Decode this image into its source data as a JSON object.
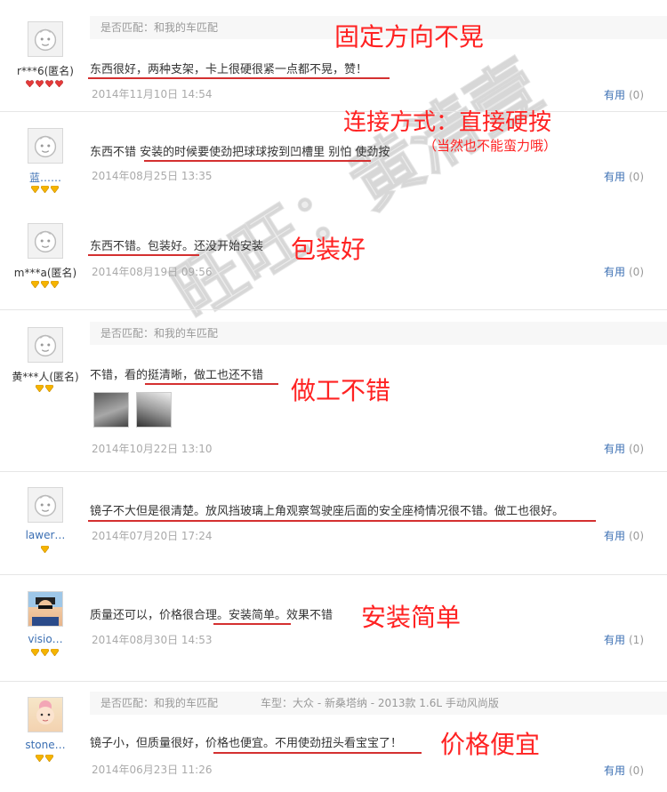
{
  "colors": {
    "annotation": "#ff2222",
    "underline": "#d43030",
    "link": "#3b6fb3",
    "date": "#aaaaaa"
  },
  "useful_label": "有用",
  "reviews": [
    {
      "user": "r***6(匿名)",
      "badge_type": "red-heart",
      "badge_count": 4,
      "match_label": "是否匹配：和我的车匹配",
      "text": "东西很好，两种支架，卡上很硬很紧一点都不晃，赞！",
      "date": "2014年11月10日 14:54",
      "useful_count": "(0)",
      "annotation": "固定方向不晃"
    },
    {
      "user": "蓝……",
      "badge_type": "yellow-diamond",
      "badge_count": 3,
      "text": "东西不错 安装的时候要使劲把球球按到凹槽里 别怕 使劲按",
      "date": "2014年08月25日 13:35",
      "useful_count": "(0)",
      "annotation": "连接方式：直接硬按",
      "annotation_sub": "（当然也不能蛮力哦）"
    },
    {
      "user": "m***a(匿名)",
      "badge_type": "yellow-diamond",
      "badge_count": 3,
      "text": "东西不错。包装好。还没开始安装",
      "date": "2014年08月19日 09:56",
      "useful_count": "(0)",
      "annotation": "包装好"
    },
    {
      "user": "黄***人(匿名)",
      "badge_type": "yellow-diamond",
      "badge_count": 2,
      "match_label": "是否匹配：和我的车匹配",
      "text": "不错，看的挺清晰，做工也还不错",
      "date": "2014年10月22日 13:10",
      "useful_count": "(0)",
      "annotation": "做工不错",
      "photos": [
        "photo-1",
        "photo-2"
      ]
    },
    {
      "user": "lawer…",
      "badge_type": "yellow-diamond",
      "badge_count": 1,
      "text": "镜子不大但是很清楚。放风挡玻璃上角观察驾驶座后面的安全座椅情况很不错。做工也很好。",
      "date": "2014年07月20日 17:24",
      "useful_count": "(0)"
    },
    {
      "user": "visio…",
      "badge_type": "yellow-diamond",
      "badge_count": 3,
      "text": "质量还可以，价格很合理。安装简单。效果不错",
      "date": "2014年08月30日 14:53",
      "useful_count": "(1)",
      "annotation": "安装简单"
    },
    {
      "user": "stone…",
      "badge_type": "yellow-diamond",
      "badge_count": 2,
      "match_label": "是否匹配：和我的车匹配",
      "car_model": "车型：大众 - 新桑塔纳 - 2013款 1.6L 手动风尚版",
      "text": "镜子小，但质量很好，价格也便宜。不用使劲扭头看宝宝了！",
      "date": "2014年06月23日 11:26",
      "useful_count": "(0)",
      "annotation": "价格便宜"
    }
  ],
  "watermark": "旺旺：黄清壹"
}
